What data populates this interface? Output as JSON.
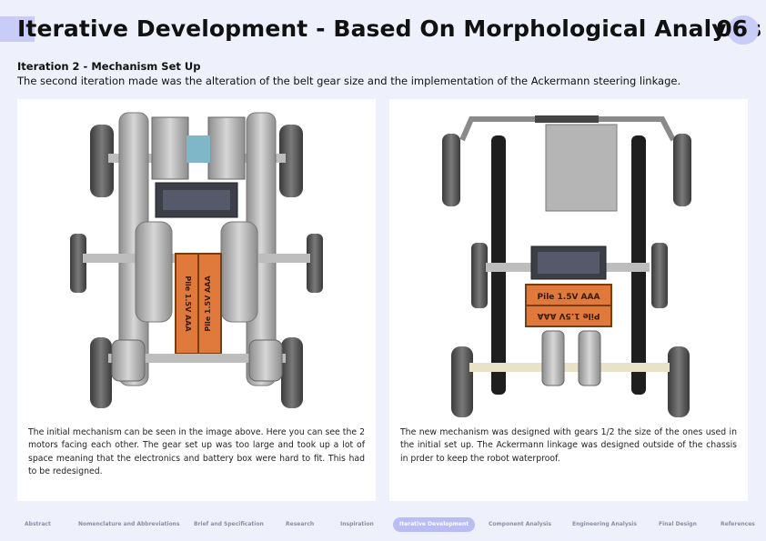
{
  "header": {
    "title": "Iterative Development - Based On Morphological Analysis",
    "page_number": "06"
  },
  "section": {
    "heading": "Iteration 2 - Mechanism Set Up",
    "intro": "The second iteration made was the alteration of the belt gear size and the implementation of the Ackermann steering linkage."
  },
  "left_card": {
    "battery_label": "Pile 1.5V AAA",
    "caption": "The initial mechanism can be seen in the image above. Here you can see the 2 motors facing each other. The gear set up was too large and took up a lot of space meaning that the electronics and battery box were hard to fit. This had to be redesigned."
  },
  "right_card": {
    "battery_label": "Pile 1.5V AAA",
    "caption": "The new mechanism was designed with gears 1/2 the size of the ones used in the initial set up. The Ackermann linkage was designed outside of the chassis in prder to keep the robot waterproof."
  },
  "nav": {
    "items": [
      "Abstract",
      "Nomenclature and Abbreviations",
      "Brief and Specification",
      "Research",
      "Inspiration",
      "Iterative Development",
      "Component Analysis",
      "Engineering Analysis",
      "Final Design",
      "References"
    ],
    "active": "Iterative Development"
  },
  "colors": {
    "background": "#eef0fb",
    "accent": "#c9ccf6",
    "nav_active": "#b9bdf3",
    "battery": "#e07a3c"
  }
}
